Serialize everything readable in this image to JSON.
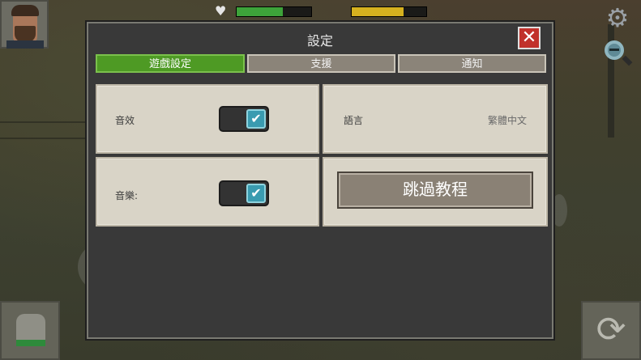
{
  "dialog": {
    "title": "設定",
    "close_glyph": "✕"
  },
  "tabs": [
    {
      "label": "遊戲設定",
      "active": true
    },
    {
      "label": "支援",
      "active": false
    },
    {
      "label": "通知",
      "active": false
    }
  ],
  "settings": {
    "sound_label": "音效",
    "sound_enabled": true,
    "music_label": "音樂:",
    "music_enabled": true,
    "language_label": "語言",
    "language_value": "繁體中文",
    "skip_tutorial_label": "跳過教程"
  },
  "toggle_check_glyph": "✔",
  "hud": {
    "gear_glyph": "⚙",
    "refresh_glyph": "⟳",
    "heart_glyph": "♥",
    "health_fraction": 0.62,
    "stamina_fraction": 0.7
  },
  "colors": {
    "active_tab": "#4e9a24",
    "close_button": "#c1312b",
    "toggle_knob": "#3a9bb0",
    "health_bar": "#3da33a",
    "stamina_bar": "#d6b11f"
  }
}
